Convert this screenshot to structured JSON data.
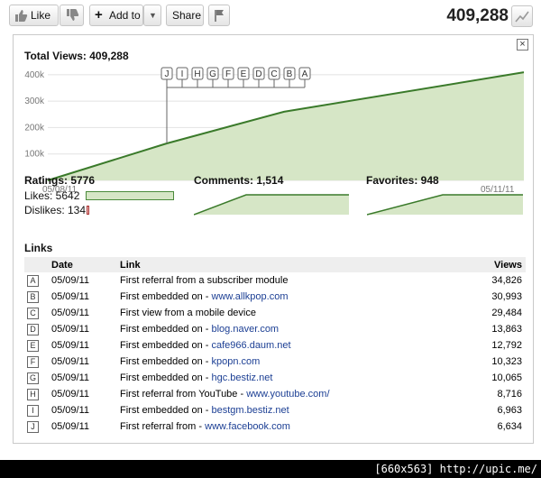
{
  "toolbar": {
    "like_label": "Like",
    "add_to_label": "Add to",
    "share_label": "Share",
    "total_views": "409,288"
  },
  "panel": {
    "total_views_label": "Total Views: 409,288",
    "chart_x_start": "05/08/11",
    "chart_x_end": "05/11/11",
    "y_ticks": [
      "400k",
      "300k",
      "200k",
      "100k",
      "0"
    ],
    "markers": [
      "J",
      "I",
      "H",
      "G",
      "F",
      "E",
      "D",
      "C",
      "B",
      "A"
    ],
    "ratings_label": "Ratings: 5776",
    "likes_label": "Likes: 5642",
    "dislikes_label": "Dislikes: 134",
    "likes": 5642,
    "dislikes": 134,
    "comments_label": "Comments: 1,514",
    "favorites_label": "Favorites: 948",
    "links_title": "Links",
    "headers": {
      "date": "Date",
      "link": "Link",
      "views": "Views"
    },
    "links": [
      {
        "marker": "A",
        "date": "05/09/11",
        "text": "First referral from a subscriber module",
        "link": "",
        "views": "34,826"
      },
      {
        "marker": "B",
        "date": "05/09/11",
        "text": "First embedded on - ",
        "link": "www.allkpop.com",
        "views": "30,993"
      },
      {
        "marker": "C",
        "date": "05/09/11",
        "text": "First view from a mobile device",
        "link": "",
        "views": "29,484"
      },
      {
        "marker": "D",
        "date": "05/09/11",
        "text": "First embedded on - ",
        "link": "blog.naver.com",
        "views": "13,863"
      },
      {
        "marker": "E",
        "date": "05/09/11",
        "text": "First embedded on - ",
        "link": "cafe966.daum.net",
        "views": "12,792"
      },
      {
        "marker": "F",
        "date": "05/09/11",
        "text": "First embedded on - ",
        "link": "kpopn.com",
        "views": "10,323"
      },
      {
        "marker": "G",
        "date": "05/09/11",
        "text": "First embedded on - ",
        "link": "hgc.bestiz.net",
        "views": "10,065"
      },
      {
        "marker": "H",
        "date": "05/09/11",
        "text": "First referral from YouTube - ",
        "link": "www.youtube.com/",
        "views": "8,716"
      },
      {
        "marker": "I",
        "date": "05/09/11",
        "text": "First embedded on - ",
        "link": "bestgm.bestiz.net",
        "views": "6,963"
      },
      {
        "marker": "J",
        "date": "05/09/11",
        "text": "First referral from - ",
        "link": "www.facebook.com",
        "views": "6,634"
      }
    ]
  },
  "chart_data": {
    "type": "area",
    "title": "Total Views: 409,288",
    "x": [
      "05/08/11",
      "05/09/11",
      "05/10/11",
      "05/11/11"
    ],
    "values": [
      0,
      140000,
      260000,
      409288
    ],
    "ylim": [
      0,
      420000
    ],
    "grid": true,
    "fill_color": "#d6e6c6",
    "line_color": "#3a7a2a"
  },
  "watermark": "[660x563] http://upic.me/"
}
